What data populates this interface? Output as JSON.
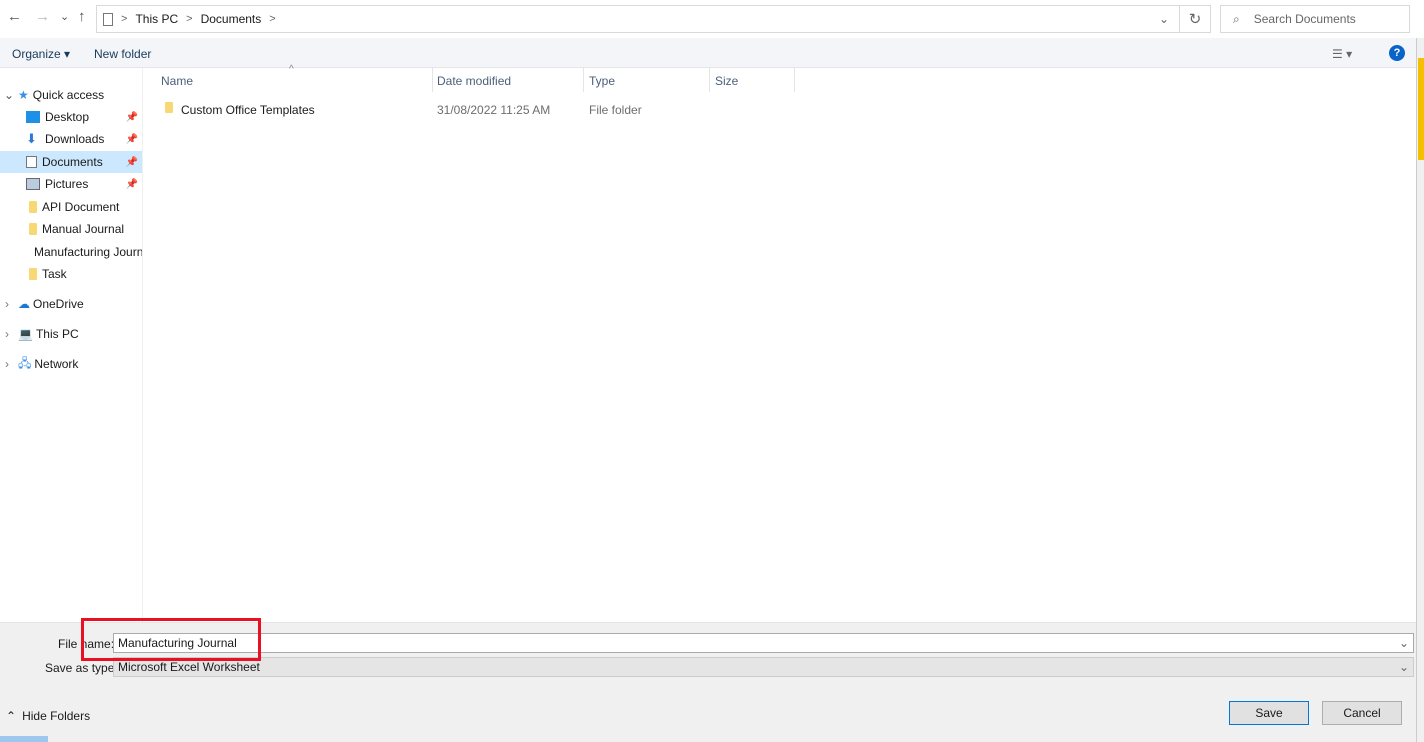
{
  "nav": {
    "back": "←",
    "forward": "→",
    "recent": "⌄",
    "up": "↑"
  },
  "address": {
    "crumbs": [
      "This PC",
      "Documents"
    ]
  },
  "search": {
    "placeholder": "Search Documents"
  },
  "toolbar": {
    "organize": "Organize ▾",
    "new_folder": "New folder",
    "help": "?"
  },
  "sidebar": {
    "quick_access": "Quick access",
    "items": [
      {
        "label": "Desktop",
        "pinned": true
      },
      {
        "label": "Downloads",
        "pinned": true
      },
      {
        "label": "Documents",
        "pinned": true,
        "selected": true
      },
      {
        "label": "Pictures",
        "pinned": true
      },
      {
        "label": "API Document"
      },
      {
        "label": "Manual Journal"
      },
      {
        "label": "Manufacturing Journal"
      },
      {
        "label": "Task"
      }
    ],
    "roots": [
      "OneDrive",
      "This PC",
      "Network"
    ]
  },
  "columns": [
    "Name",
    "Date modified",
    "Type",
    "Size"
  ],
  "files": [
    {
      "name": "Custom Office Templates",
      "date": "31/08/2022 11:25 AM",
      "type": "File folder",
      "size": ""
    }
  ],
  "footer": {
    "file_name_label": "File name:",
    "file_name": "Manufacturing Journal",
    "type_label": "Save as type:",
    "type": "Microsoft Excel Worksheet",
    "hide_folders": "Hide Folders",
    "save": "Save",
    "cancel": "Cancel"
  },
  "colors": {
    "selected": "#cce8ff",
    "highlight_box": "#e81123",
    "accent": "#0a64c8"
  }
}
